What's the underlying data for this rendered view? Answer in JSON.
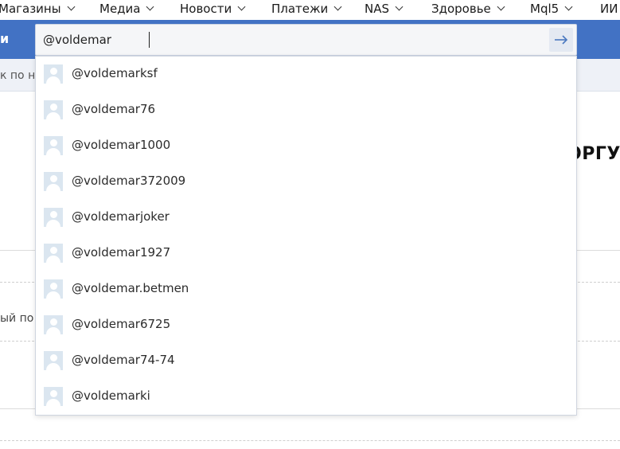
{
  "nav": {
    "items": [
      {
        "label": "Магазины"
      },
      {
        "label": "Медиа"
      },
      {
        "label": "Новости"
      },
      {
        "label": "Платежи"
      },
      {
        "label": "NAS"
      },
      {
        "label": "Здоровье"
      },
      {
        "label": "Mql5"
      },
      {
        "label": "ИИ"
      }
    ]
  },
  "header": {
    "title": "и"
  },
  "subbar": {
    "text": "к по не"
  },
  "background": {
    "heading": "ОРГУ",
    "side_text": "ый по"
  },
  "search": {
    "value": "@voldemar",
    "go_icon": "arrow-right-icon"
  },
  "suggestions": [
    {
      "name": "@voldemarksf"
    },
    {
      "name": "@voldemar76"
    },
    {
      "name": "@voldemar1000"
    },
    {
      "name": "@voldemar372009"
    },
    {
      "name": "@voldemarjoker"
    },
    {
      "name": "@voldemar1927"
    },
    {
      "name": "@voldemar.betmen"
    },
    {
      "name": "@voldemar6725"
    },
    {
      "name": "@voldemar74-74"
    },
    {
      "name": "@voldemarki"
    }
  ],
  "colors": {
    "header_blue": "#4272c4",
    "accent_arrow": "#4a78c0"
  }
}
